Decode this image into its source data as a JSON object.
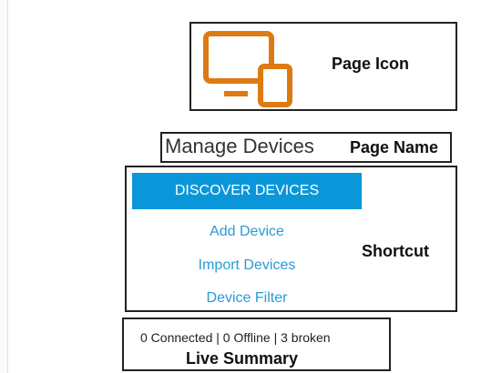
{
  "page_icon": {
    "icon": "devices-icon",
    "color": "#de7a12",
    "callout": "Page Icon"
  },
  "page_name": {
    "title": "Manage Devices",
    "callout": "Page Name"
  },
  "shortcut": {
    "primary_label": "DISCOVER DEVICES",
    "primary_color": "#0a97d9",
    "links": [
      "Add Device",
      "Import Devices",
      "Device Filter"
    ],
    "link_color": "#2a9bd6",
    "callout": "Shortcut"
  },
  "live_summary": {
    "status": "0 Connected | 0 Offline | 3 broken",
    "callout": "Live Summary"
  }
}
